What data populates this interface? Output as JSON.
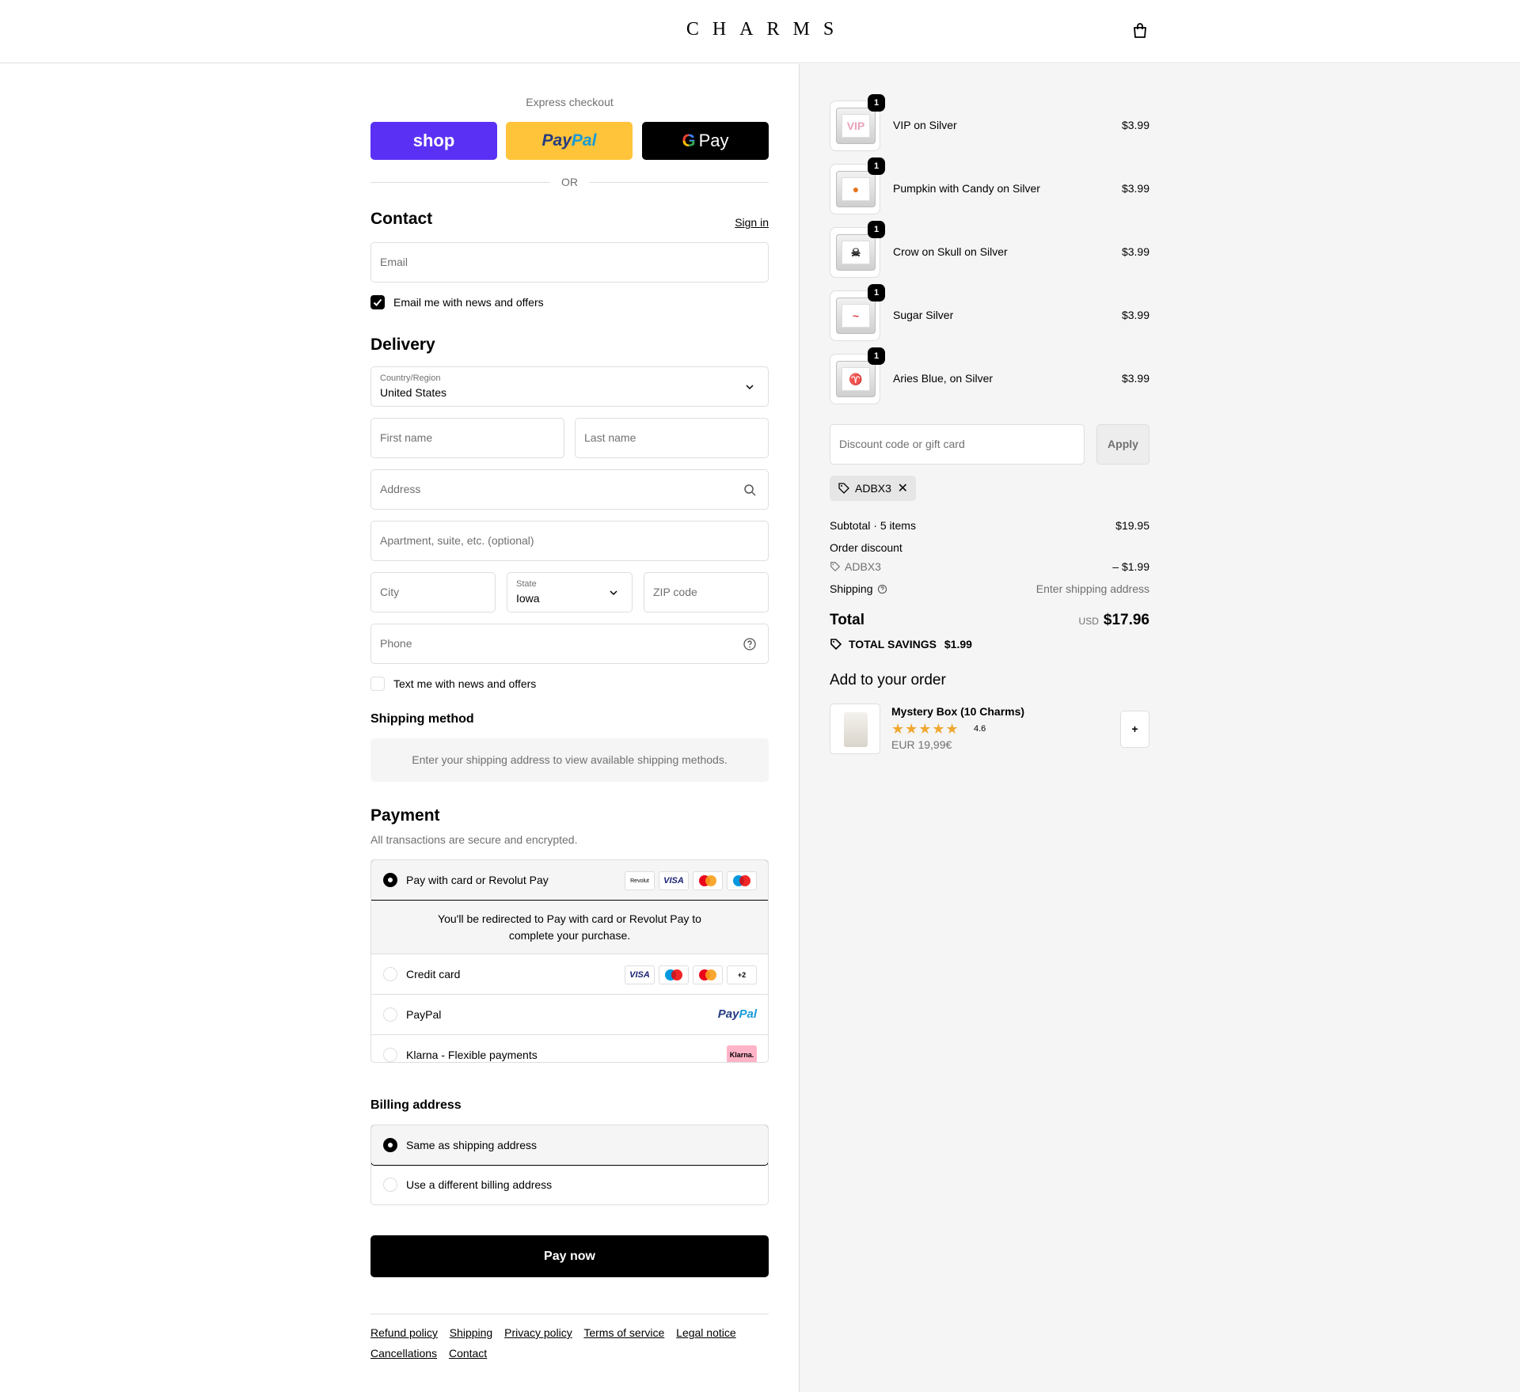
{
  "header": {
    "logo": "CHARMS",
    "cart_icon": "shopping-bag-icon"
  },
  "express": {
    "title": "Express checkout",
    "shop_label": "shop",
    "paypal_label_1": "Pay",
    "paypal_label_2": "Pal",
    "gpay_g": "G",
    "gpay_label": "Pay",
    "or_label": "OR"
  },
  "contact": {
    "heading": "Contact",
    "sign_in": "Sign in",
    "email_placeholder": "Email",
    "news_label": "Email me with news and offers",
    "news_checked": true
  },
  "delivery": {
    "heading": "Delivery",
    "country_label": "Country/Region",
    "country_value": "United States",
    "first_name_placeholder": "First name",
    "last_name_placeholder": "Last name",
    "address_placeholder": "Address",
    "apartment_placeholder": "Apartment, suite, etc. (optional)",
    "city_placeholder": "City",
    "state_label": "State",
    "state_value": "Iowa",
    "zip_placeholder": "ZIP code",
    "phone_placeholder": "Phone",
    "text_label": "Text me with news and offers",
    "text_checked": false
  },
  "shipping_method": {
    "heading": "Shipping method",
    "message": "Enter your shipping address to view available shipping methods."
  },
  "payment": {
    "heading": "Payment",
    "subtitle": "All transactions are secure and encrypted.",
    "options": [
      {
        "label": "Pay with card or Revolut Pay",
        "selected": true
      },
      {
        "label": "Credit card",
        "selected": false
      },
      {
        "label": "PayPal",
        "selected": false
      },
      {
        "label": "Klarna - Flexible payments",
        "selected": false
      }
    ],
    "redirect_message": "You'll be redirected to Pay with card or Revolut Pay to complete your purchase.",
    "badges": {
      "revolut": "Revolut",
      "visa": "VISA",
      "more": "+2",
      "paypal_1": "Pay",
      "paypal_2": "Pal",
      "klarna": "Klarna."
    }
  },
  "billing": {
    "heading": "Billing address",
    "options": [
      {
        "label": "Same as shipping address",
        "selected": true
      },
      {
        "label": "Use a different billing address",
        "selected": false
      }
    ]
  },
  "pay_now": "Pay now",
  "footer": {
    "links": [
      "Refund policy",
      "Shipping",
      "Privacy policy",
      "Terms of service",
      "Legal notice",
      "Cancellations",
      "Contact"
    ]
  },
  "cart": {
    "items": [
      {
        "name": "VIP on Silver",
        "price": "$3.99",
        "qty": "1",
        "face": "VIP",
        "face_color": "#e8a3b8"
      },
      {
        "name": "Pumpkin with Candy on Silver",
        "price": "$3.99",
        "qty": "1",
        "face": "●",
        "face_color": "#e8731f"
      },
      {
        "name": "Crow on Skull on Silver",
        "price": "$3.99",
        "qty": "1",
        "face": "☠",
        "face_color": "#222222"
      },
      {
        "name": "Sugar Silver",
        "price": "$3.99",
        "qty": "1",
        "face": "~",
        "face_color": "#d83b3b"
      },
      {
        "name": "Aries Blue, on Silver",
        "price": "$3.99",
        "qty": "1",
        "face": "♈",
        "face_color": "#2a8fd6"
      }
    ]
  },
  "discount": {
    "placeholder": "Discount code or gift card",
    "apply": "Apply",
    "code": "ADBX3"
  },
  "summary": {
    "subtotal_label": "Subtotal · 5 items",
    "subtotal_value": "$19.95",
    "order_discount_label": "Order discount",
    "discount_code": "ADBX3",
    "discount_value": "– $1.99",
    "shipping_label": "Shipping",
    "shipping_value": "Enter shipping address",
    "total_label": "Total",
    "currency": "USD",
    "total_value": "$17.96",
    "savings_label": "TOTAL SAVINGS",
    "savings_value": "$1.99"
  },
  "upsell": {
    "heading": "Add to your order",
    "name": "Mystery Box (10 Charms)",
    "stars": "★★★★★",
    "rating": "4.6",
    "rating_value": 4.6,
    "price": "EUR 19,99€",
    "add_label": "+"
  },
  "colors": {
    "shop_purple": "#5a31f4",
    "paypal_yellow": "#ffc439",
    "accent": "#000000",
    "summary_bg": "#f5f5f5",
    "star": "#f0a830",
    "klarna_pink": "#ffb3c7"
  }
}
